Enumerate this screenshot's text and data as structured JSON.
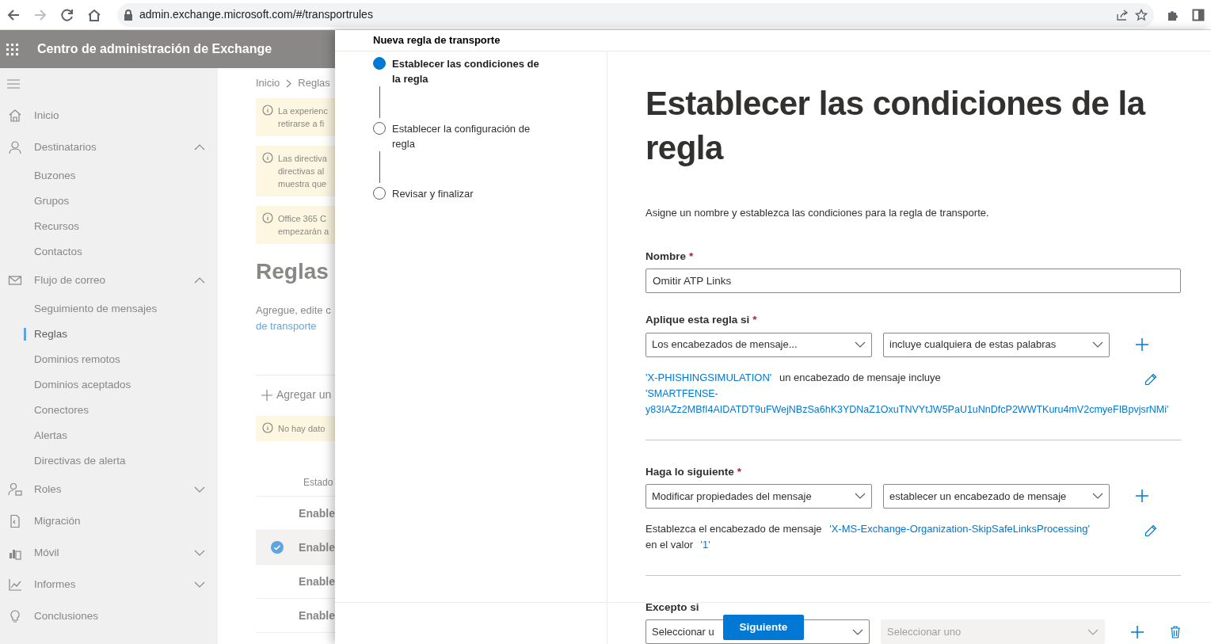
{
  "browser": {
    "url": "admin.exchange.microsoft.com/#/transportrules"
  },
  "app_header": {
    "title": "Centro de administración de Exchange"
  },
  "sidebar": {
    "items": [
      {
        "label": "Inicio"
      },
      {
        "label": "Destinatarios",
        "expanded": true,
        "children": [
          {
            "label": "Buzones",
            "selected": false
          },
          {
            "label": "Grupos",
            "selected": false
          },
          {
            "label": "Recursos",
            "selected": false
          },
          {
            "label": "Contactos",
            "selected": false
          }
        ]
      },
      {
        "label": "Flujo de correo",
        "expanded": true,
        "children": [
          {
            "label": "Seguimiento de mensajes",
            "selected": false
          },
          {
            "label": "Reglas",
            "selected": true
          },
          {
            "label": "Dominios remotos",
            "selected": false
          },
          {
            "label": "Dominios aceptados",
            "selected": false
          },
          {
            "label": "Conectores",
            "selected": false
          },
          {
            "label": "Alertas",
            "selected": false
          },
          {
            "label": "Directivas de alerta",
            "selected": false
          }
        ]
      },
      {
        "label": "Roles",
        "expanded": false
      },
      {
        "label": "Migración"
      },
      {
        "label": "Móvil",
        "expanded": false
      },
      {
        "label": "Informes",
        "expanded": false
      },
      {
        "label": "Conclusiones"
      }
    ]
  },
  "rules_page": {
    "breadcrumb": [
      "Inicio",
      "Reglas"
    ],
    "notices": [
      {
        "lines": [
          "La experienc",
          "retirarse a fi"
        ]
      },
      {
        "lines": [
          "Las directiva",
          "directivas al",
          "muestra que"
        ]
      },
      {
        "lines": [
          "Office 365 C",
          "empezarán a"
        ]
      }
    ],
    "title": "Reglas",
    "description": {
      "text": "Agregue, edite c",
      "link": "de transporte"
    },
    "add_button": "Agregar un",
    "empty_notice": "No hay dato",
    "table": {
      "columns": [
        "Estado"
      ],
      "rows": [
        {
          "cells": [
            "Enable"
          ],
          "selected": false
        },
        {
          "cells": [
            "Enable"
          ],
          "selected": true
        },
        {
          "cells": [
            "Enable"
          ],
          "selected": false
        },
        {
          "cells": [
            "Enable"
          ],
          "selected": false
        }
      ]
    }
  },
  "panel": {
    "title": "Nueva regla de transporte",
    "steps": [
      {
        "label": "Establecer las condiciones de la regla",
        "selected": true
      },
      {
        "label": "Establecer la configuración de regla",
        "selected": false
      },
      {
        "label": "Revisar y finalizar",
        "selected": false
      }
    ],
    "heading": "Establecer las condiciones de la regla",
    "description": "Asigne un nombre y establezca las condiciones para la regla de transporte.",
    "name_field": {
      "label": "Nombre",
      "required_mark": "*",
      "value": "Omitir ATP Links"
    },
    "sections": [
      {
        "label": "Aplique esta regla si",
        "required_mark": "*",
        "selects": [
          {
            "value": "Los encabezados de mensaje...",
            "disabled": false
          },
          {
            "value": "incluye cualquiera de estas palabras",
            "disabled": false
          }
        ],
        "summary": [
          {
            "kind": "link",
            "text": "'X-PHISHINGSIMULATION'"
          },
          {
            "kind": "text",
            "text": "un encabezado de mensaje incluye"
          },
          {
            "kind": "value",
            "text": "'SMARTFENSE-y83IAZz2MBfI4AIDATDT9uFWejNBzSa6hK3YDNaZ1OxuTNVYtJW5PaU1uNnDfcP2WWTKuru4mV2cmyeFIBpvjsrNMi'"
          }
        ]
      },
      {
        "label": "Haga lo siguiente",
        "required_mark": "*",
        "selects": [
          {
            "value": "Modificar propiedades del mensaje",
            "disabled": false
          },
          {
            "value": "establecer un encabezado de mensaje",
            "disabled": false
          }
        ],
        "summary": [
          {
            "kind": "text",
            "text": "Establezca el encabezado de mensaje"
          },
          {
            "kind": "link",
            "text": "'X-MS-Exchange-Organization-SkipSafeLinksProcessing'"
          },
          {
            "kind": "text",
            "text": "en el valor"
          },
          {
            "kind": "link",
            "text": "'1'"
          }
        ]
      },
      {
        "label": "Excepto si",
        "selects": [
          {
            "value": "Seleccionar u",
            "disabled": false
          },
          {
            "value": "Seleccionar uno",
            "disabled": true
          }
        ],
        "deletable": true
      }
    ],
    "next_button": "Siguiente"
  }
}
